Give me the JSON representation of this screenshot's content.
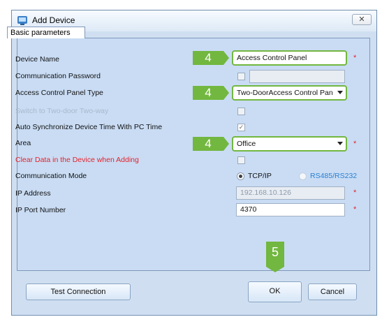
{
  "window": {
    "title": "Add Device",
    "close_glyph": "✕"
  },
  "tab": {
    "label": "Basic parameters"
  },
  "rows": {
    "device_name": {
      "label": "Device Name",
      "value": "Access Control Panel",
      "required": "*"
    },
    "comm_password": {
      "label": "Communication Password",
      "value": ""
    },
    "panel_type": {
      "label": "Access Control Panel Type",
      "value": "Two-DoorAccess Control Pan"
    },
    "switch_two_way": {
      "label": "Switch to Two-door Two-way"
    },
    "auto_sync": {
      "label": "Auto Synchronize Device Time With PC Time",
      "checked_glyph": "✓"
    },
    "area": {
      "label": "Area",
      "value": "Office",
      "required": "*"
    },
    "clear_data": {
      "label": "Clear Data in the Device when Adding"
    },
    "comm_mode": {
      "label": "Communication Mode",
      "opt1": "TCP/IP",
      "opt2": "RS485/RS232"
    },
    "ip_address": {
      "label": "IP Address",
      "value": "192.168.10.126",
      "required": "*"
    },
    "ip_port": {
      "label": "IP Port Number",
      "value": "4370",
      "required": "*"
    }
  },
  "badges": {
    "step4": "4",
    "step5": "5"
  },
  "buttons": {
    "test": "Test Connection",
    "ok": "OK",
    "cancel": "Cancel"
  },
  "colors": {
    "accent_green": "#72b73f",
    "required_red": "#e4222b",
    "panel_bg": "#c9dcf4"
  }
}
